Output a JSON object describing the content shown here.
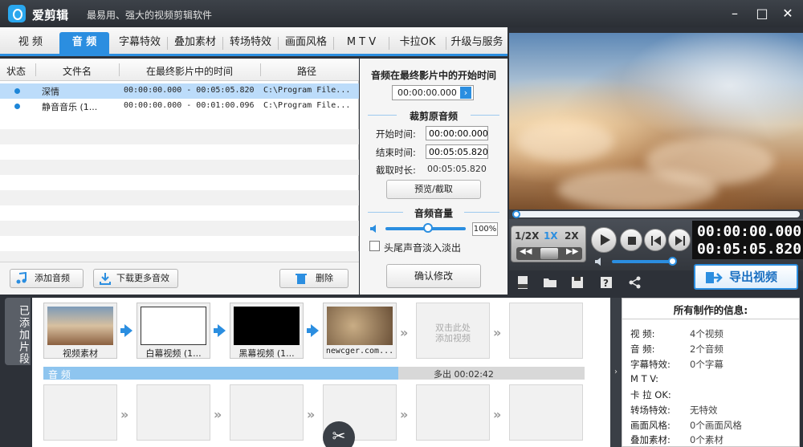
{
  "titlebar": {
    "app_name": "爱剪辑",
    "slogan": "最易用、强大的视频剪辑软件",
    "minimize": "–",
    "maximize": "□",
    "close": "✕"
  },
  "tabs": [
    "视 频",
    "音 频",
    "字幕特效",
    "叠加素材",
    "转场特效",
    "画面风格",
    "M T V",
    "卡拉OK",
    "升级与服务"
  ],
  "active_tab": "音 频",
  "audio_table": {
    "headers": [
      "状态",
      "文件名",
      "在最终影片中的时间",
      "路径"
    ],
    "rows": [
      {
        "name": "深情",
        "time": "00:00:00.000 - 00:05:05.820",
        "path": "C:\\Program File..."
      },
      {
        "name": "静音音乐 (1...",
        "time": "00:00:00.000 - 00:01:00.096",
        "path": "C:\\Program File..."
      }
    ]
  },
  "left_buttons": {
    "add_audio": "添加音频",
    "download_more": "下载更多音效",
    "delete": "删除"
  },
  "audio_settings": {
    "start_title": "音频在最终影片中的开始时间",
    "start_time": "00:00:00.000",
    "trim_title": "裁剪原音频",
    "begin_label": "开始时间:",
    "begin_value": "00:00:00.000",
    "end_label": "结束时间:",
    "end_value": "00:05:05.820",
    "duration_label": "截取时长:",
    "duration_value": "00:05:05.820",
    "preview_button": "预览/截取",
    "volume_title": "音频音量",
    "volume_value": "100%",
    "volume_level": 1.0,
    "fade_label": "头尾声音淡入淡出",
    "confirm_button": "确认修改"
  },
  "player": {
    "speeds": [
      "1/2X",
      "1X",
      "2X"
    ],
    "current_speed": "1X",
    "current_time": "00:00:00.000",
    "total_time": "00:05:05.820",
    "progress": 0.0,
    "volume_level": 0.92
  },
  "export_button": "导出视频",
  "timeline": {
    "added_label": "已添加片段",
    "clips": [
      {
        "label": "视频素材"
      },
      {
        "label": "白幕视频 (1..."
      },
      {
        "label": "黑幕视频 (1..."
      },
      {
        "label": "newcger.com..."
      }
    ],
    "add_hint": "双击此处添加视频",
    "audio_track_label": "音 频",
    "audio_excess": "多出 00:02:42"
  },
  "info": {
    "title": "所有制作的信息:",
    "items": [
      {
        "label": "视    频:",
        "value": "4个视频"
      },
      {
        "label": "音    频:",
        "value": "2个音频"
      },
      {
        "label": "字幕特效:",
        "value": "0个字幕"
      },
      {
        "label": "M  T  V:",
        "value": ""
      },
      {
        "label": "卡 拉 OK:",
        "value": ""
      },
      {
        "label": "转场特效:",
        "value": "无特效"
      },
      {
        "label": "画面风格:",
        "value": "0个画面风格"
      },
      {
        "label": "叠加素材:",
        "value": "0个素材"
      }
    ]
  },
  "colors": {
    "accent": "#2b8ee0",
    "selected_row": "#bcdcfa",
    "dark_bg": "#2d3138"
  }
}
